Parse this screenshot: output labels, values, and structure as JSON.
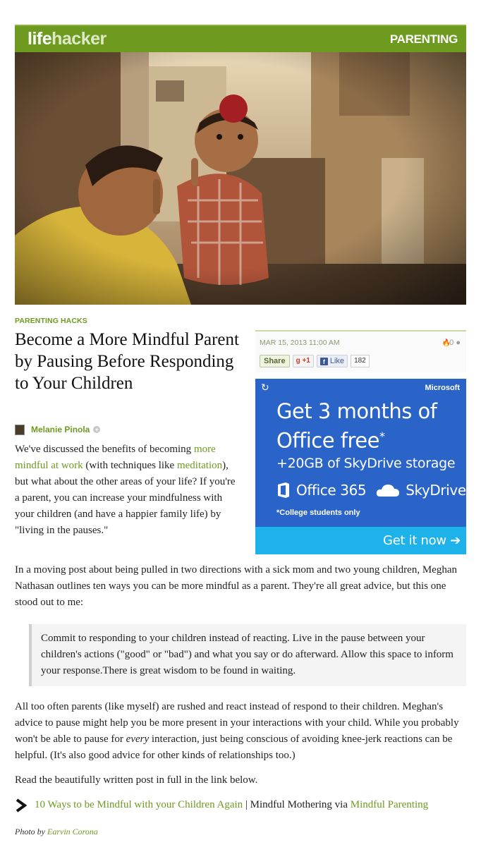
{
  "header": {
    "logo_life": "life",
    "logo_hacker": "hacker",
    "section": "PARENTING"
  },
  "article": {
    "kicker": "PARENTING HACKS",
    "title": "Become a More Mindful Parent by Pausing Before Responding to Your Children",
    "author": "Melanie Pinola",
    "date": "MAR 15, 2013 11:00 AM",
    "comment_count": "0",
    "share_label": "Share",
    "gplus_label": "+1",
    "like_label": "Like",
    "like_count": "182",
    "p1": {
      "t1": "We've discussed the benefits of becoming ",
      "link1": "more mindful at work",
      "t2": " (with techniques like ",
      "link2": "meditation",
      "t3": "), but what about the other areas of your life? If you're a parent, you can increase your mindfulness with your children (and have a happier family life) by \"living in the pauses.\""
    },
    "p2": "In a moving post about being pulled in two directions with a sick mom and two young children, Meghan Nathasan outlines ten ways you can be more mindful as a parent. They're all great advice, but this one stood out to me:",
    "quote": "Commit to responding to your children instead of reacting. Live in the pause between your children's actions (\"good\" or \"bad\") and what you say or do afterward. Allow this space to inform your response.There is great wisdom to be found in waiting.",
    "p3": {
      "t1": "All too often parents (like myself) are rushed and react instead of respond to their children. Meghan's advice to pause might help you be more present in your interactions with your child. While you probably won't be able to pause for ",
      "em": "every",
      "t2": " interaction, just being conscious of avoiding knee-jerk reactions can be helpful. (It's also good advice for other kinds of relationships too.)"
    },
    "p4": "Read the beautifully written post in full in the link below.",
    "related": {
      "link1": "10 Ways to be Mindful with your Children Again",
      "sep": " | Mindful Mothering via ",
      "link2": "Mindful Parenting"
    },
    "photo_credit": {
      "prefix": "Photo by ",
      "name": "Earvin Corona"
    }
  },
  "ad": {
    "brand": "Microsoft",
    "headline1": "Get 3 months of",
    "headline2": "Office free",
    "headline_mark": "*",
    "sub": "+20GB of SkyDrive storage",
    "product1": "Office 365",
    "product2": "SkyDrive",
    "note": "*College students only",
    "cta": "Get it now"
  },
  "colors": {
    "accent": "#6d9a1f",
    "ad_blue": "#2a64c9",
    "ad_cta": "#1db3ea"
  }
}
